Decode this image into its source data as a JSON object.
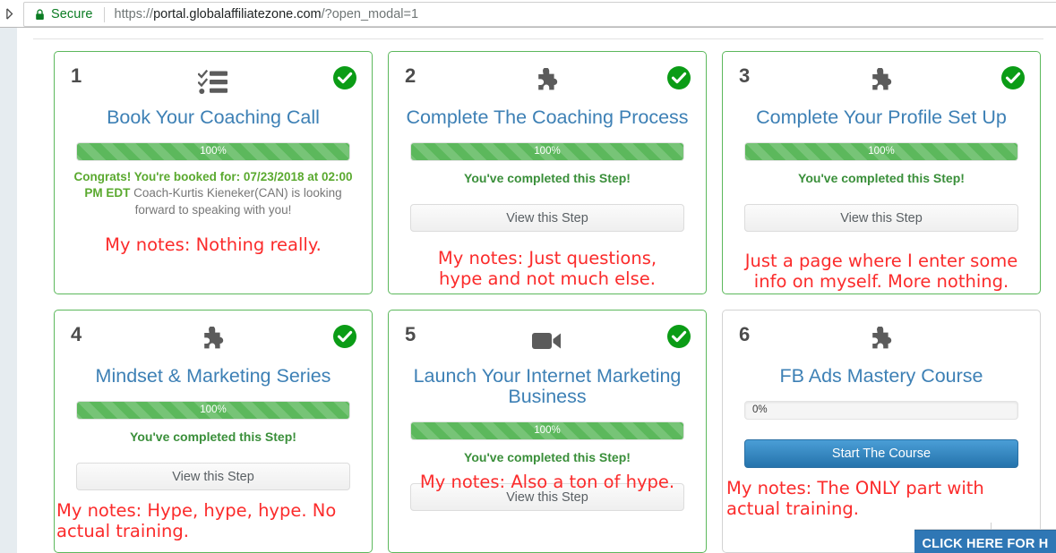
{
  "browser": {
    "back_icon": "back-arrow-icon",
    "lock_icon": "lock-icon",
    "secure_label": "Secure",
    "url_scheme": "https://",
    "url_host": "portal.globalaffiliatezone.com",
    "url_path": "/?open_modal=1",
    "url_full": "https://portal.globalaffiliatezone.com/?open_modal=1"
  },
  "colors": {
    "card_border_complete": "#5cb85c",
    "card_border_incomplete": "#d3d3d3",
    "progress_green": "#5cb85c",
    "title_blue": "#3d80b5",
    "status_green": "#3a8f3a",
    "note_red": "#fb2b2b",
    "primary_blue": "#2f77b5"
  },
  "cards": [
    {
      "number": "1",
      "icon": "tasklist-icon",
      "title": "Book Your Coaching Call",
      "badge": "check-circle-icon",
      "complete": true,
      "progress_label": "100%",
      "progress_value": 100,
      "congrats_bold": "Congrats! You're booked for: 07/23/2018 at 02:00 PM EDT",
      "congrats_rest": " Coach-Kurtis Kieneker(CAN) is looking forward to speaking with you!",
      "button": null,
      "note": "My notes: Nothing really."
    },
    {
      "number": "2",
      "icon": "puzzle-piece-icon",
      "title": "Complete The Coaching Process",
      "badge": "check-circle-icon",
      "complete": true,
      "progress_label": "100%",
      "progress_value": 100,
      "status": "You've completed this Step!",
      "button": "View this Step",
      "note": "My notes: Just questions,\nhype and not much else."
    },
    {
      "number": "3",
      "icon": "puzzle-piece-icon",
      "title": "Complete Your Profile Set Up",
      "badge": "check-circle-icon",
      "complete": true,
      "progress_label": "100%",
      "progress_value": 100,
      "status": "You've completed this Step!",
      "button": "View this Step",
      "note": "Just a page where I enter some\ninfo on myself. More nothing."
    },
    {
      "number": "4",
      "icon": "puzzle-piece-icon",
      "title": "Mindset & Marketing Series",
      "badge": "check-circle-icon",
      "complete": true,
      "progress_label": "100%",
      "progress_value": 100,
      "status": "You've completed this Step!",
      "button": "View this Step",
      "note": "My notes: Hype, hype, hype. No\nactual training."
    },
    {
      "number": "5",
      "icon": "video-camera-icon",
      "title": "Launch Your Internet Marketing Business",
      "badge": "check-circle-icon",
      "complete": true,
      "progress_label": "100%",
      "progress_value": 100,
      "status": "You've completed this Step!",
      "button": "View this Step",
      "note": "My notes: Also a ton of hype."
    },
    {
      "number": "6",
      "icon": "puzzle-piece-icon",
      "title": "FB Ads Mastery Course",
      "badge": null,
      "complete": false,
      "progress_label": "0%",
      "progress_value": 0,
      "button": "Start The Course",
      "note": "My notes: The ONLY part with\nactual training."
    }
  ],
  "help_fab": {
    "label": "CLICK HERE FOR H"
  }
}
